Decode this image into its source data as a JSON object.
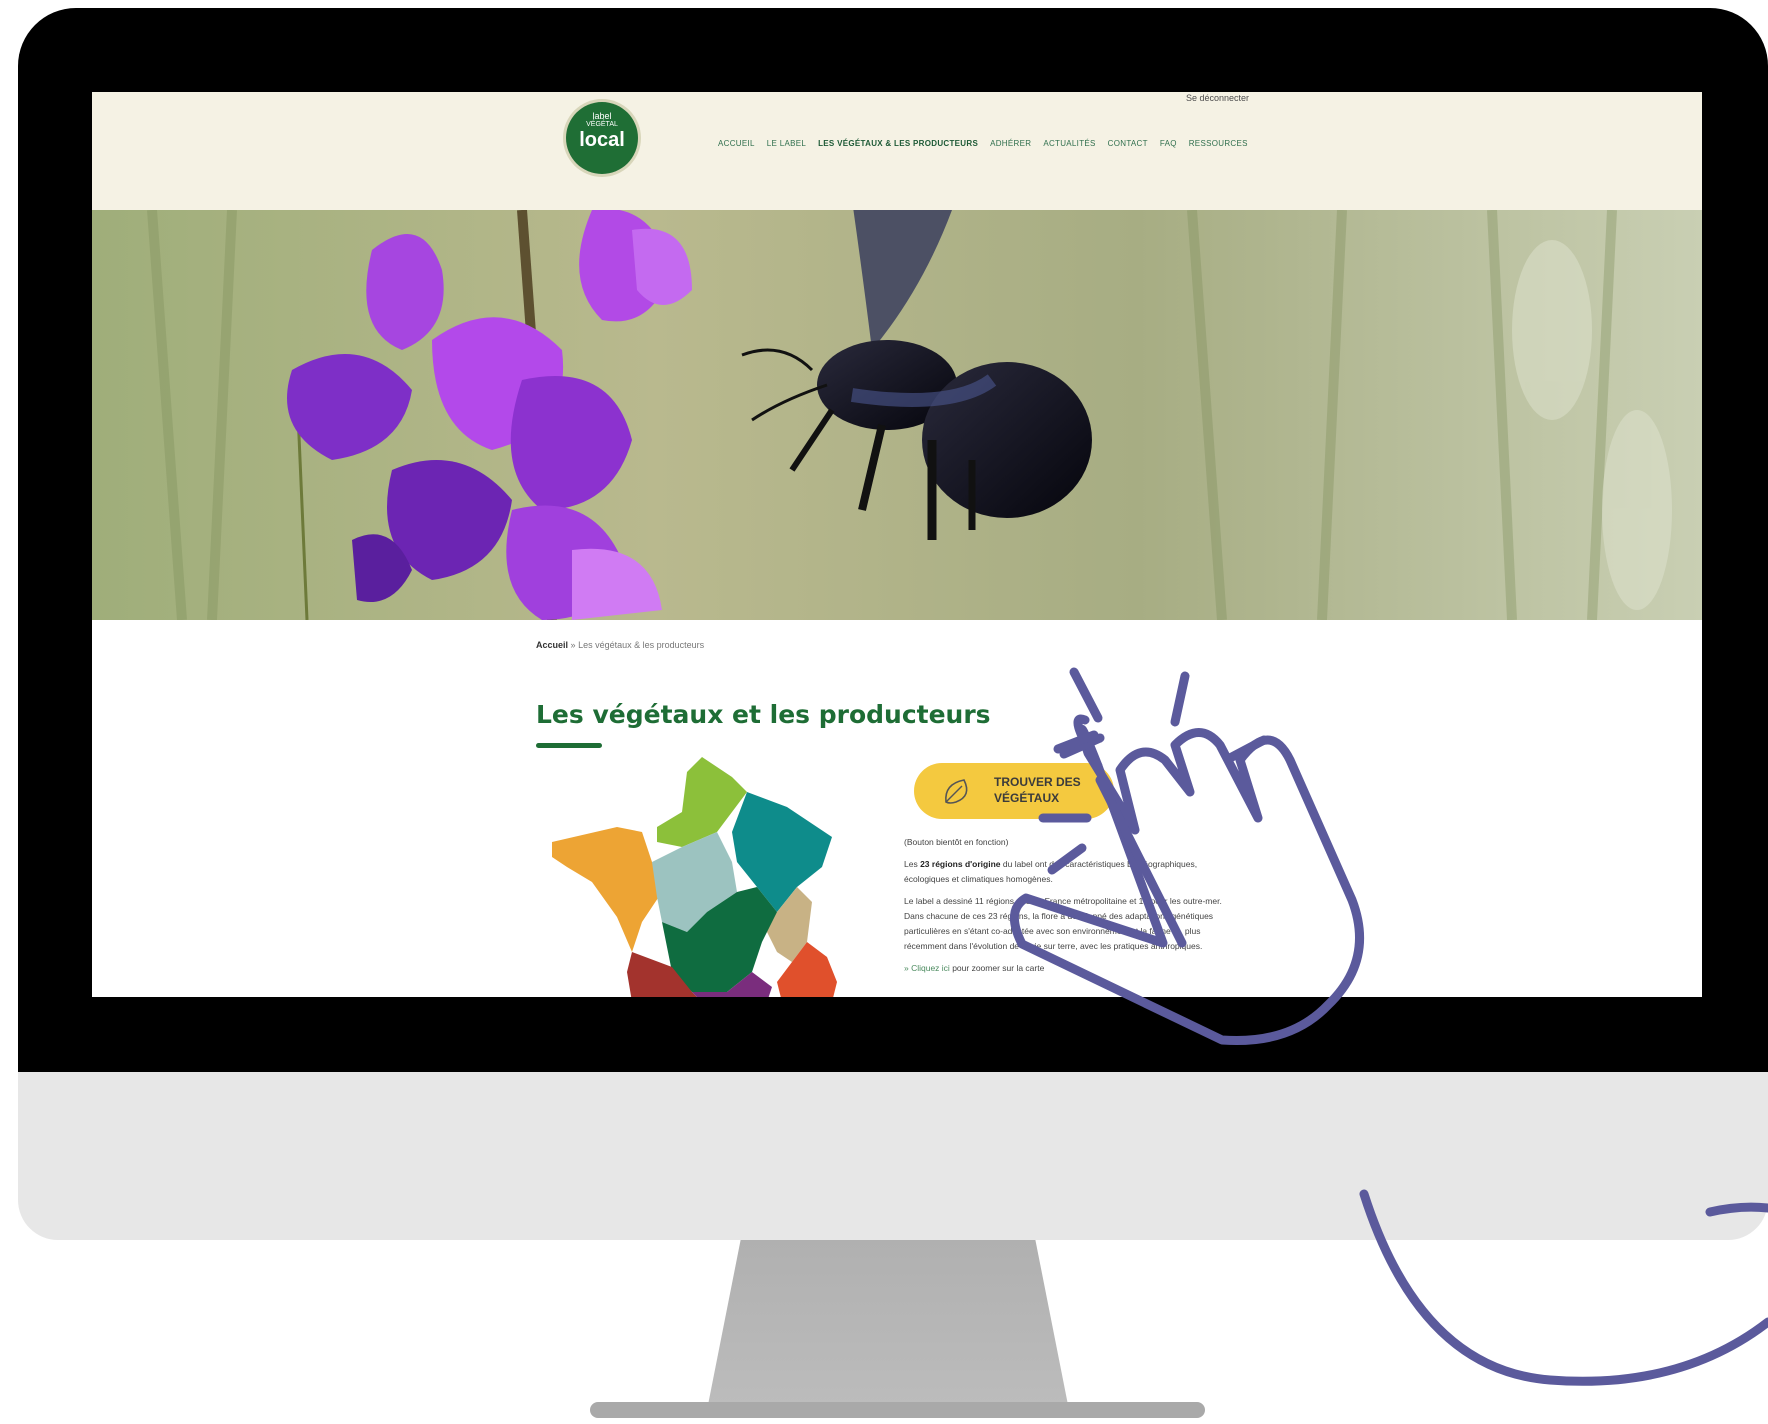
{
  "header": {
    "logout": "Se déconnecter",
    "logo": {
      "line1": "label",
      "line2": "VÉGÉTAL",
      "line3": "local"
    },
    "nav": [
      {
        "label": "ACCUEIL",
        "active": false
      },
      {
        "label": "LE LABEL",
        "active": false
      },
      {
        "label": "LES VÉGÉTAUX & LES PRODUCTEURS",
        "active": true
      },
      {
        "label": "ADHÉRER",
        "active": false
      },
      {
        "label": "ACTUALITÉS",
        "active": false
      },
      {
        "label": "CONTACT",
        "active": false
      },
      {
        "label": "FAQ",
        "active": false
      },
      {
        "label": "RESSOURCES",
        "active": false
      }
    ]
  },
  "breadcrumb": {
    "home": "Accueil",
    "separator": "»",
    "current": "Les végétaux & les producteurs"
  },
  "main": {
    "title": "Les végétaux et les producteurs",
    "cta_label": "TROUVER DES VÉGÉTAUX",
    "status_note": "(Bouton bientôt en fonction)",
    "para1_start": "Les ",
    "para1_bold": "23 régions d'origine",
    "para1_end": " du label ont des caractéristiques biogéographiques, écologiques et climatiques homogènes.",
    "para2": "Le label a dessiné 11 régions pour la France métropolitaine et 12 pour les outre-mer. Dans chacune de ces 23 régions, la flore a développé des adaptations génétiques particulières en s'étant co-adaptée avec son environnement et la faune et, plus récemment dans l'évolution de la vie sur terre, avec les pratiques anthropiques.",
    "para3_link": "» Cliquez ici",
    "para3_text": " pour zoomer sur la carte"
  },
  "colors": {
    "brand_green": "#1e6d35",
    "header_bg": "#f5f2e4",
    "cta_yellow": "#f4c93f",
    "hand_stroke": "#5b5a9c"
  },
  "icons": [
    "leaf-icon",
    "pointing-hand-icon"
  ]
}
